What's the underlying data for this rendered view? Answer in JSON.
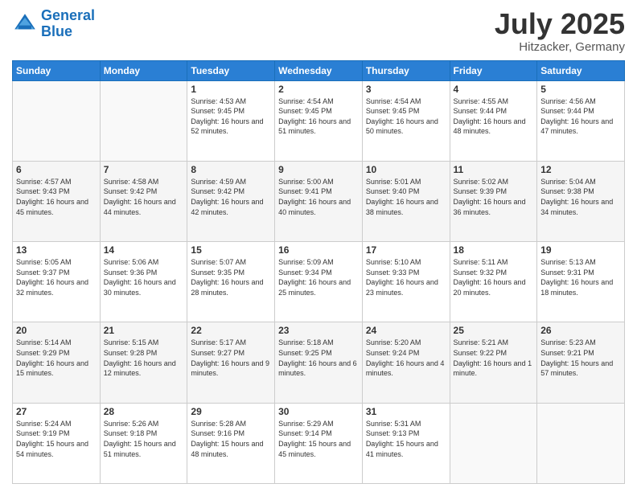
{
  "header": {
    "logo_line1": "General",
    "logo_line2": "Blue",
    "month": "July 2025",
    "location": "Hitzacker, Germany"
  },
  "weekdays": [
    "Sunday",
    "Monday",
    "Tuesday",
    "Wednesday",
    "Thursday",
    "Friday",
    "Saturday"
  ],
  "rows": [
    [
      {
        "day": "",
        "sunrise": "",
        "sunset": "",
        "daylight": ""
      },
      {
        "day": "",
        "sunrise": "",
        "sunset": "",
        "daylight": ""
      },
      {
        "day": "1",
        "sunrise": "Sunrise: 4:53 AM",
        "sunset": "Sunset: 9:45 PM",
        "daylight": "Daylight: 16 hours and 52 minutes."
      },
      {
        "day": "2",
        "sunrise": "Sunrise: 4:54 AM",
        "sunset": "Sunset: 9:45 PM",
        "daylight": "Daylight: 16 hours and 51 minutes."
      },
      {
        "day": "3",
        "sunrise": "Sunrise: 4:54 AM",
        "sunset": "Sunset: 9:45 PM",
        "daylight": "Daylight: 16 hours and 50 minutes."
      },
      {
        "day": "4",
        "sunrise": "Sunrise: 4:55 AM",
        "sunset": "Sunset: 9:44 PM",
        "daylight": "Daylight: 16 hours and 48 minutes."
      },
      {
        "day": "5",
        "sunrise": "Sunrise: 4:56 AM",
        "sunset": "Sunset: 9:44 PM",
        "daylight": "Daylight: 16 hours and 47 minutes."
      }
    ],
    [
      {
        "day": "6",
        "sunrise": "Sunrise: 4:57 AM",
        "sunset": "Sunset: 9:43 PM",
        "daylight": "Daylight: 16 hours and 45 minutes."
      },
      {
        "day": "7",
        "sunrise": "Sunrise: 4:58 AM",
        "sunset": "Sunset: 9:42 PM",
        "daylight": "Daylight: 16 hours and 44 minutes."
      },
      {
        "day": "8",
        "sunrise": "Sunrise: 4:59 AM",
        "sunset": "Sunset: 9:42 PM",
        "daylight": "Daylight: 16 hours and 42 minutes."
      },
      {
        "day": "9",
        "sunrise": "Sunrise: 5:00 AM",
        "sunset": "Sunset: 9:41 PM",
        "daylight": "Daylight: 16 hours and 40 minutes."
      },
      {
        "day": "10",
        "sunrise": "Sunrise: 5:01 AM",
        "sunset": "Sunset: 9:40 PM",
        "daylight": "Daylight: 16 hours and 38 minutes."
      },
      {
        "day": "11",
        "sunrise": "Sunrise: 5:02 AM",
        "sunset": "Sunset: 9:39 PM",
        "daylight": "Daylight: 16 hours and 36 minutes."
      },
      {
        "day": "12",
        "sunrise": "Sunrise: 5:04 AM",
        "sunset": "Sunset: 9:38 PM",
        "daylight": "Daylight: 16 hours and 34 minutes."
      }
    ],
    [
      {
        "day": "13",
        "sunrise": "Sunrise: 5:05 AM",
        "sunset": "Sunset: 9:37 PM",
        "daylight": "Daylight: 16 hours and 32 minutes."
      },
      {
        "day": "14",
        "sunrise": "Sunrise: 5:06 AM",
        "sunset": "Sunset: 9:36 PM",
        "daylight": "Daylight: 16 hours and 30 minutes."
      },
      {
        "day": "15",
        "sunrise": "Sunrise: 5:07 AM",
        "sunset": "Sunset: 9:35 PM",
        "daylight": "Daylight: 16 hours and 28 minutes."
      },
      {
        "day": "16",
        "sunrise": "Sunrise: 5:09 AM",
        "sunset": "Sunset: 9:34 PM",
        "daylight": "Daylight: 16 hours and 25 minutes."
      },
      {
        "day": "17",
        "sunrise": "Sunrise: 5:10 AM",
        "sunset": "Sunset: 9:33 PM",
        "daylight": "Daylight: 16 hours and 23 minutes."
      },
      {
        "day": "18",
        "sunrise": "Sunrise: 5:11 AM",
        "sunset": "Sunset: 9:32 PM",
        "daylight": "Daylight: 16 hours and 20 minutes."
      },
      {
        "day": "19",
        "sunrise": "Sunrise: 5:13 AM",
        "sunset": "Sunset: 9:31 PM",
        "daylight": "Daylight: 16 hours and 18 minutes."
      }
    ],
    [
      {
        "day": "20",
        "sunrise": "Sunrise: 5:14 AM",
        "sunset": "Sunset: 9:29 PM",
        "daylight": "Daylight: 16 hours and 15 minutes."
      },
      {
        "day": "21",
        "sunrise": "Sunrise: 5:15 AM",
        "sunset": "Sunset: 9:28 PM",
        "daylight": "Daylight: 16 hours and 12 minutes."
      },
      {
        "day": "22",
        "sunrise": "Sunrise: 5:17 AM",
        "sunset": "Sunset: 9:27 PM",
        "daylight": "Daylight: 16 hours and 9 minutes."
      },
      {
        "day": "23",
        "sunrise": "Sunrise: 5:18 AM",
        "sunset": "Sunset: 9:25 PM",
        "daylight": "Daylight: 16 hours and 6 minutes."
      },
      {
        "day": "24",
        "sunrise": "Sunrise: 5:20 AM",
        "sunset": "Sunset: 9:24 PM",
        "daylight": "Daylight: 16 hours and 4 minutes."
      },
      {
        "day": "25",
        "sunrise": "Sunrise: 5:21 AM",
        "sunset": "Sunset: 9:22 PM",
        "daylight": "Daylight: 16 hours and 1 minute."
      },
      {
        "day": "26",
        "sunrise": "Sunrise: 5:23 AM",
        "sunset": "Sunset: 9:21 PM",
        "daylight": "Daylight: 15 hours and 57 minutes."
      }
    ],
    [
      {
        "day": "27",
        "sunrise": "Sunrise: 5:24 AM",
        "sunset": "Sunset: 9:19 PM",
        "daylight": "Daylight: 15 hours and 54 minutes."
      },
      {
        "day": "28",
        "sunrise": "Sunrise: 5:26 AM",
        "sunset": "Sunset: 9:18 PM",
        "daylight": "Daylight: 15 hours and 51 minutes."
      },
      {
        "day": "29",
        "sunrise": "Sunrise: 5:28 AM",
        "sunset": "Sunset: 9:16 PM",
        "daylight": "Daylight: 15 hours and 48 minutes."
      },
      {
        "day": "30",
        "sunrise": "Sunrise: 5:29 AM",
        "sunset": "Sunset: 9:14 PM",
        "daylight": "Daylight: 15 hours and 45 minutes."
      },
      {
        "day": "31",
        "sunrise": "Sunrise: 5:31 AM",
        "sunset": "Sunset: 9:13 PM",
        "daylight": "Daylight: 15 hours and 41 minutes."
      },
      {
        "day": "",
        "sunrise": "",
        "sunset": "",
        "daylight": ""
      },
      {
        "day": "",
        "sunrise": "",
        "sunset": "",
        "daylight": ""
      }
    ]
  ]
}
